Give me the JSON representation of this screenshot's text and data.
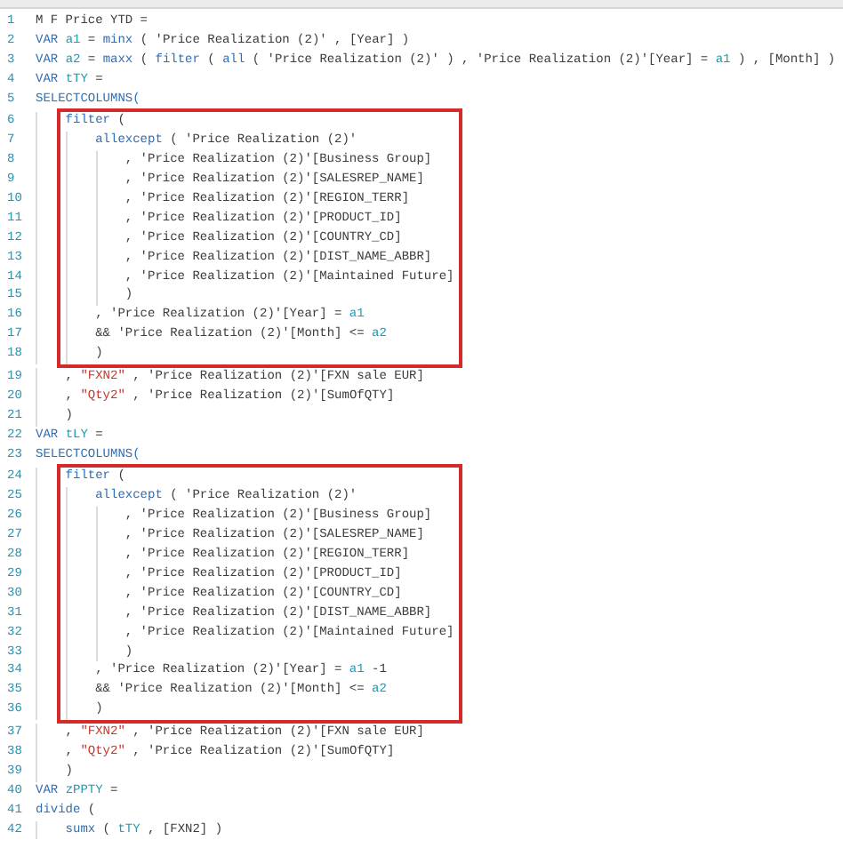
{
  "editor": {
    "blocks": [
      {
        "kind": "plain",
        "lines": [
          {
            "number": "1",
            "tokens": [
              {
                "kind": "plain",
                "text": "M F Price YTD ="
              }
            ]
          },
          {
            "number": "2",
            "tokens": [
              {
                "kind": "keyword",
                "text": "VAR "
              },
              {
                "kind": "variable",
                "text": "a1"
              },
              {
                "kind": "plain",
                "text": " = "
              },
              {
                "kind": "keyword",
                "text": "minx"
              },
              {
                "kind": "plain",
                "text": " ( 'Price Realization (2)' , [Year] )"
              }
            ]
          },
          {
            "number": "3",
            "tokens": [
              {
                "kind": "keyword",
                "text": "VAR "
              },
              {
                "kind": "variable",
                "text": "a2"
              },
              {
                "kind": "plain",
                "text": " = "
              },
              {
                "kind": "keyword",
                "text": "maxx"
              },
              {
                "kind": "plain",
                "text": " ( "
              },
              {
                "kind": "keyword",
                "text": "filter"
              },
              {
                "kind": "plain",
                "text": " ( "
              },
              {
                "kind": "keyword",
                "text": "all"
              },
              {
                "kind": "plain",
                "text": " ( 'Price Realization (2)' ) , 'Price Realization (2)'[Year] = "
              },
              {
                "kind": "variable",
                "text": "a1"
              },
              {
                "kind": "plain",
                "text": " ) , [Month] )"
              }
            ]
          },
          {
            "number": "4",
            "tokens": [
              {
                "kind": "keyword",
                "text": "VAR "
              },
              {
                "kind": "variable",
                "text": "tTY"
              },
              {
                "kind": "plain",
                "text": " ="
              }
            ]
          },
          {
            "number": "5",
            "tokens": [
              {
                "kind": "keyword",
                "text": "SELECTCOLUMNS("
              }
            ]
          }
        ]
      },
      {
        "kind": "boxed",
        "lines": [
          {
            "number": "6",
            "tokens": [
              {
                "kind": "keyword",
                "text": "    filter"
              },
              {
                "kind": "plain",
                "text": " ("
              }
            ]
          },
          {
            "number": "7",
            "tokens": [
              {
                "kind": "keyword",
                "text": "        allexcept"
              },
              {
                "kind": "plain",
                "text": " ( 'Price Realization (2)'"
              }
            ]
          },
          {
            "number": "8",
            "tokens": [
              {
                "kind": "plain",
                "text": "            , 'Price Realization (2)'[Business Group]"
              }
            ]
          },
          {
            "number": "9",
            "tokens": [
              {
                "kind": "plain",
                "text": "            , 'Price Realization (2)'[SALESREP_NAME]"
              }
            ]
          },
          {
            "number": "10",
            "tokens": [
              {
                "kind": "plain",
                "text": "            , 'Price Realization (2)'[REGION_TERR]"
              }
            ]
          },
          {
            "number": "11",
            "tokens": [
              {
                "kind": "plain",
                "text": "            , 'Price Realization (2)'[PRODUCT_ID]"
              }
            ]
          },
          {
            "number": "12",
            "tokens": [
              {
                "kind": "plain",
                "text": "            , 'Price Realization (2)'[COUNTRY_CD]"
              }
            ]
          },
          {
            "number": "13",
            "tokens": [
              {
                "kind": "plain",
                "text": "            , 'Price Realization (2)'[DIST_NAME_ABBR]"
              }
            ]
          },
          {
            "number": "14",
            "tokens": [
              {
                "kind": "plain",
                "text": "            , 'Price Realization (2)'[Maintained Future]"
              }
            ]
          },
          {
            "number": "15",
            "tokens": [
              {
                "kind": "plain",
                "text": "            )"
              }
            ]
          },
          {
            "number": "16",
            "tokens": [
              {
                "kind": "plain",
                "text": "        , 'Price Realization (2)'[Year] = "
              },
              {
                "kind": "variable",
                "text": "a1"
              }
            ]
          },
          {
            "number": "17",
            "tokens": [
              {
                "kind": "plain",
                "text": "        && 'Price Realization (2)'[Month] <= "
              },
              {
                "kind": "variable",
                "text": "a2"
              }
            ]
          },
          {
            "number": "18",
            "tokens": [
              {
                "kind": "plain",
                "text": "        )"
              }
            ]
          }
        ]
      },
      {
        "kind": "plain",
        "lines": [
          {
            "number": "19",
            "tokens": [
              {
                "kind": "plain",
                "text": "    , "
              },
              {
                "kind": "string",
                "text": "\"FXN2\""
              },
              {
                "kind": "plain",
                "text": " , 'Price Realization (2)'[FXN sale EUR]"
              }
            ]
          },
          {
            "number": "20",
            "tokens": [
              {
                "kind": "plain",
                "text": "    , "
              },
              {
                "kind": "string",
                "text": "\"Qty2\""
              },
              {
                "kind": "plain",
                "text": " , 'Price Realization (2)'[SumOfQTY]"
              }
            ]
          },
          {
            "number": "21",
            "tokens": [
              {
                "kind": "plain",
                "text": "    )"
              }
            ]
          },
          {
            "number": "22",
            "tokens": [
              {
                "kind": "keyword",
                "text": "VAR "
              },
              {
                "kind": "variable",
                "text": "tLY"
              },
              {
                "kind": "plain",
                "text": " ="
              }
            ]
          },
          {
            "number": "23",
            "tokens": [
              {
                "kind": "keyword",
                "text": "SELECTCOLUMNS("
              }
            ]
          }
        ]
      },
      {
        "kind": "boxed",
        "lines": [
          {
            "number": "24",
            "tokens": [
              {
                "kind": "keyword",
                "text": "    filter"
              },
              {
                "kind": "plain",
                "text": " ("
              }
            ]
          },
          {
            "number": "25",
            "tokens": [
              {
                "kind": "keyword",
                "text": "        allexcept"
              },
              {
                "kind": "plain",
                "text": " ( 'Price Realization (2)'"
              }
            ]
          },
          {
            "number": "26",
            "tokens": [
              {
                "kind": "plain",
                "text": "            , 'Price Realization (2)'[Business Group]"
              }
            ]
          },
          {
            "number": "27",
            "tokens": [
              {
                "kind": "plain",
                "text": "            , 'Price Realization (2)'[SALESREP_NAME]"
              }
            ]
          },
          {
            "number": "28",
            "tokens": [
              {
                "kind": "plain",
                "text": "            , 'Price Realization (2)'[REGION_TERR]"
              }
            ]
          },
          {
            "number": "29",
            "tokens": [
              {
                "kind": "plain",
                "text": "            , 'Price Realization (2)'[PRODUCT_ID]"
              }
            ]
          },
          {
            "number": "30",
            "tokens": [
              {
                "kind": "plain",
                "text": "            , 'Price Realization (2)'[COUNTRY_CD]"
              }
            ]
          },
          {
            "number": "31",
            "tokens": [
              {
                "kind": "plain",
                "text": "            , 'Price Realization (2)'[DIST_NAME_ABBR]"
              }
            ]
          },
          {
            "number": "32",
            "tokens": [
              {
                "kind": "plain",
                "text": "            , 'Price Realization (2)'[Maintained Future]"
              }
            ]
          },
          {
            "number": "33",
            "tokens": [
              {
                "kind": "plain",
                "text": "            )"
              }
            ]
          },
          {
            "number": "34",
            "tokens": [
              {
                "kind": "plain",
                "text": "        , 'Price Realization (2)'[Year] = "
              },
              {
                "kind": "variable",
                "text": "a1"
              },
              {
                "kind": "plain",
                "text": " -1"
              }
            ]
          },
          {
            "number": "35",
            "tokens": [
              {
                "kind": "plain",
                "text": "        && 'Price Realization (2)'[Month] <= "
              },
              {
                "kind": "variable",
                "text": "a2"
              }
            ]
          },
          {
            "number": "36",
            "tokens": [
              {
                "kind": "plain",
                "text": "        )"
              }
            ]
          }
        ]
      },
      {
        "kind": "plain",
        "lines": [
          {
            "number": "37",
            "tokens": [
              {
                "kind": "plain",
                "text": "    , "
              },
              {
                "kind": "string",
                "text": "\"FXN2\""
              },
              {
                "kind": "plain",
                "text": " , 'Price Realization (2)'[FXN sale EUR]"
              }
            ]
          },
          {
            "number": "38",
            "tokens": [
              {
                "kind": "plain",
                "text": "    , "
              },
              {
                "kind": "string",
                "text": "\"Qty2\""
              },
              {
                "kind": "plain",
                "text": " , 'Price Realization (2)'[SumOfQTY]"
              }
            ]
          },
          {
            "number": "39",
            "tokens": [
              {
                "kind": "plain",
                "text": "    )"
              }
            ]
          },
          {
            "number": "40",
            "tokens": [
              {
                "kind": "keyword",
                "text": "VAR "
              },
              {
                "kind": "variable",
                "text": "zPPTY"
              },
              {
                "kind": "plain",
                "text": " ="
              }
            ]
          },
          {
            "number": "41",
            "tokens": [
              {
                "kind": "keyword",
                "text": "divide"
              },
              {
                "kind": "plain",
                "text": " ("
              }
            ]
          },
          {
            "number": "42",
            "tokens": [
              {
                "kind": "keyword",
                "text": "    sumx"
              },
              {
                "kind": "plain",
                "text": " ( "
              },
              {
                "kind": "variable",
                "text": "tTY"
              },
              {
                "kind": "plain",
                "text": " , [FXN2] )"
              }
            ]
          }
        ]
      }
    ]
  }
}
